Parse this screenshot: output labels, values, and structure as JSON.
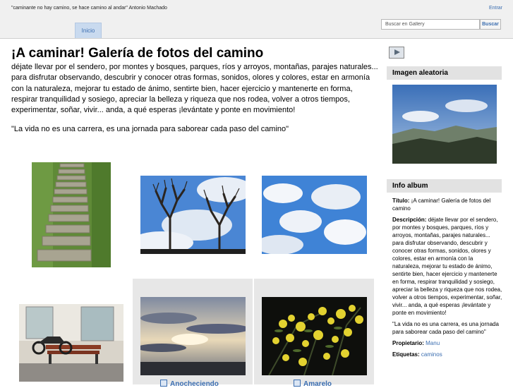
{
  "header": {
    "tagline": "\"caminante no hay camino, se hace camino al andar\" Antonio Machado",
    "login_label": "Entrar",
    "tabs": [
      {
        "label": "Inicio"
      }
    ],
    "search": {
      "placeholder": "Buscar en Gallery",
      "button_label": "Buscar"
    }
  },
  "album": {
    "title": "¡A caminar! Galería de fotos del camino",
    "description": "déjate llevar por el sendero, por montes y bosques, parques, ríos y arroyos, montañas, parajes naturales... para disfrutar observando, descubrir y conocer otras formas, sonidos, olores y colores, estar en armonía con la naturaleza, mejorar tu estado de ánimo, sentirte bien, hacer ejercicio y mantenerte en forma, respirar tranquilidad y sosiego, apreciar la belleza y riqueza que nos rodea, volver a otros tiempos, experimentar, soñar, vivir... anda, a qué esperas ¡levántate y ponte en movimiento!",
    "quote": "\"La vida no es una carrera, es una jornada para saborear cada paso del camino\""
  },
  "gallery": {
    "items": [
      {
        "icon": "stone-steps-photo"
      },
      {
        "icon": "bare-trees-photo"
      },
      {
        "icon": "clouds-sky-photo"
      },
      {
        "icon": "bench-motorbike-photo"
      },
      {
        "icon": "sunset-photo",
        "caption": "Anocheciendo"
      },
      {
        "icon": "yellow-flowers-photo",
        "caption": "Amarelo"
      }
    ]
  },
  "sidebar": {
    "slideshow_icon": "slideshow-icon",
    "random_image_title": "Imagen aleatoria",
    "album_info_title": "Info album",
    "info": {
      "title_label": "Título:",
      "title_value": "¡A caminar! Galería de fotos del camino",
      "description_label": "Descripción:",
      "description_value": "déjate llevar por el sendero, por montes y bosques, parques, ríos y arroyos, montañas, parajes naturales... para disfrutar observando, descubrir y conocer otras formas, sonidos, olores y colores, estar en armonía con la naturaleza, mejorar tu estado de ánimo, sentirte bien, hacer ejercicio y mantenerte en forma, respirar tranquilidad y sosiego, apreciar la belleza y riqueza que nos rodea, volver a otros tiempos, experimentar, soñar, vivir... anda, a qué esperas ¡levántate y ponte en movimiento!",
      "quote": "\"La vida no es una carrera, es una jornada para saborear cada paso del camino\"",
      "owner_label": "Propietario:",
      "owner_value": "Manu",
      "tags_label": "Etiquetas:",
      "tags_value": "caminos"
    }
  },
  "colors": {
    "link": "#3a6db0",
    "header_bg": "#f0f0f0",
    "tab_bg": "#c9daef",
    "block_title_bg": "#e2e2e2",
    "highlight_cell_bg": "#e7e7e7"
  }
}
